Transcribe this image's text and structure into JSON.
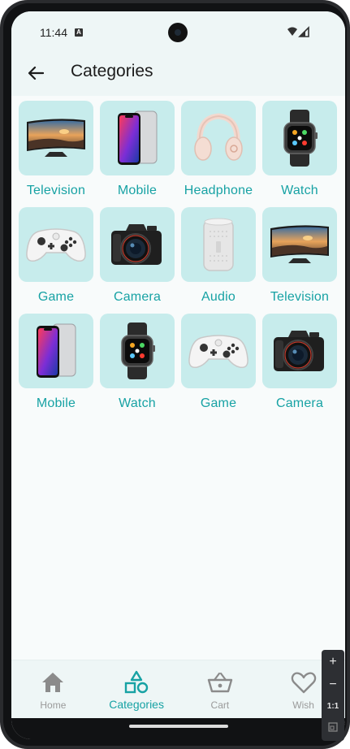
{
  "status_bar": {
    "time": "11:44",
    "notification_icon": "a-icon"
  },
  "app_bar": {
    "title": "Categories",
    "back_icon": "arrow-left-icon"
  },
  "categories": [
    {
      "label": "Television",
      "icon": "television-image"
    },
    {
      "label": "Mobile",
      "icon": "mobile-phone-image"
    },
    {
      "label": "Headphone",
      "icon": "headphone-image"
    },
    {
      "label": "Watch",
      "icon": "smartwatch-image"
    },
    {
      "label": "Game",
      "icon": "game-controller-image"
    },
    {
      "label": "Camera",
      "icon": "camera-image"
    },
    {
      "label": "Audio",
      "icon": "speaker-image"
    },
    {
      "label": "Television",
      "icon": "television-image"
    },
    {
      "label": "Mobile",
      "icon": "mobile-phone-image"
    },
    {
      "label": "Watch",
      "icon": "smartwatch-image"
    },
    {
      "label": "Game",
      "icon": "game-controller-image"
    },
    {
      "label": "Camera",
      "icon": "camera-image"
    }
  ],
  "bottom_nav": [
    {
      "label": "Home",
      "icon": "home-icon",
      "active": false
    },
    {
      "label": "Categories",
      "icon": "categories-icon",
      "active": true
    },
    {
      "label": "Cart",
      "icon": "basket-icon",
      "active": false
    },
    {
      "label": "Wish",
      "icon": "heart-icon",
      "active": false
    }
  ],
  "emulator_toolbar": {
    "zoom_in": "+",
    "zoom_out": "−",
    "actual_size": "1:1"
  },
  "colors": {
    "accent": "#17a2a4",
    "tile_bg": "#c7ecec",
    "inactive": "#9a9a9a"
  }
}
